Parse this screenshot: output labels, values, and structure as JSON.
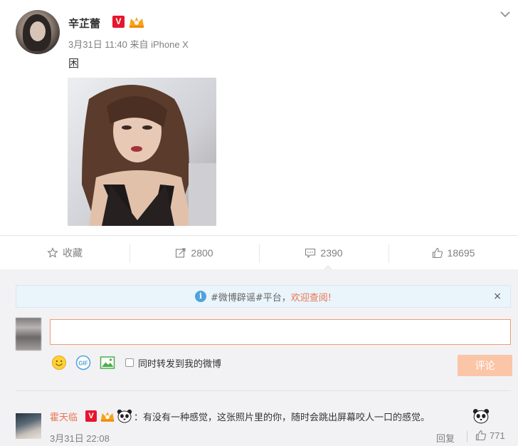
{
  "post": {
    "username": "辛芷蕾",
    "verified_badge": "V",
    "meta": "3月31日 11:40 来自 iPhone X",
    "text": "困",
    "icons": {
      "verified": "verified-v-icon",
      "member": "crown-icon",
      "menu": "chevron-down-icon"
    }
  },
  "actions": {
    "favorite_label": "收藏",
    "repost_count": "2800",
    "comment_count": "2390",
    "like_count": "18695"
  },
  "notice": {
    "info_glyph": "i",
    "text_prefix": "#微博辟谣#平台，",
    "link_text": "欢迎查阅!",
    "close_glyph": "×"
  },
  "composer": {
    "input_value": "",
    "forward_label": "同时转发到我的微博",
    "submit_label": "评论",
    "tools": [
      "smiley-icon",
      "gif-icon",
      "image-icon"
    ]
  },
  "comment": {
    "username": "霍天临",
    "verified_badge": "V",
    "text": "：有没有一种感觉，这张照片里的你，随时会跳出屏幕咬人一口的感觉。",
    "time": "3月31日 22:08",
    "reply_label": "回复",
    "like_count": "771"
  },
  "colors": {
    "accent_orange": "#eb7350",
    "verified_red": "#e6162d",
    "submit_disabled": "#fbc5a8",
    "notice_bg": "#eaf4fb"
  }
}
